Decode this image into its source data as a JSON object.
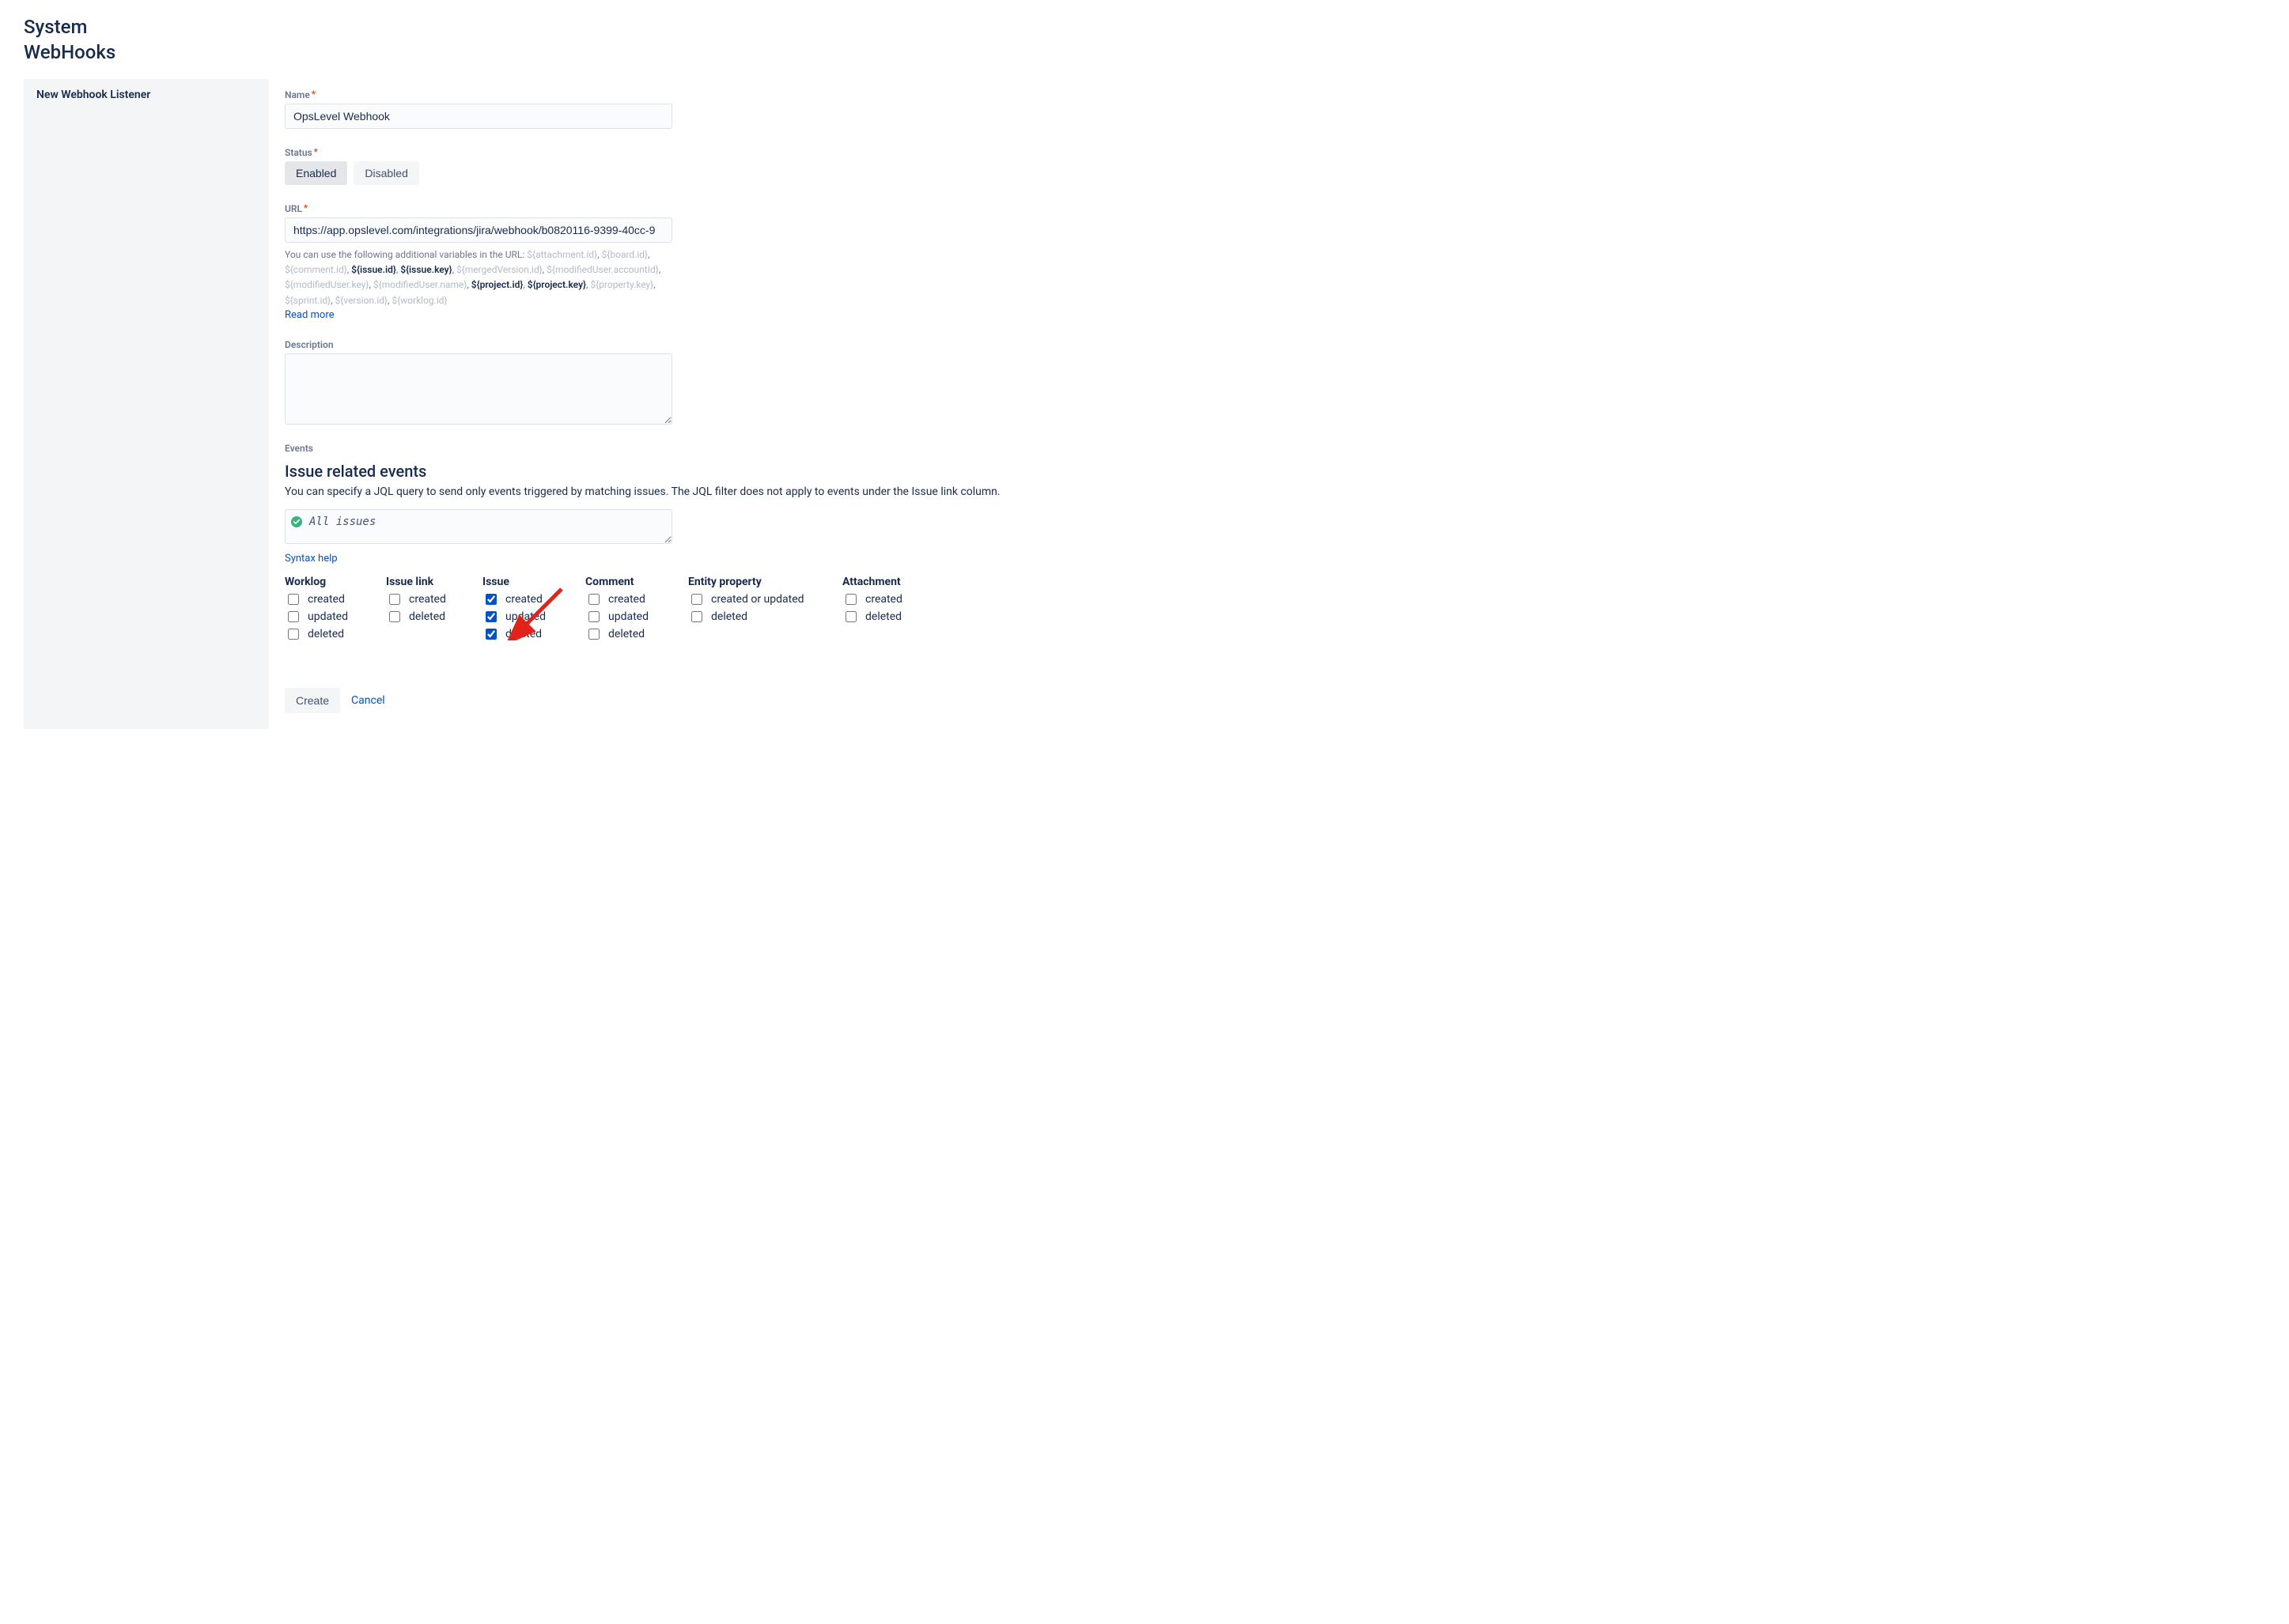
{
  "header": {
    "system": "System",
    "webhooks": "WebHooks"
  },
  "sidebar": {
    "title": "New Webhook Listener"
  },
  "form": {
    "name_label": "Name",
    "name_value": "OpsLevel Webhook",
    "status_label": "Status",
    "status_enabled": "Enabled",
    "status_disabled": "Disabled",
    "status_selected": "Enabled",
    "url_label": "URL",
    "url_value": "https://app.opslevel.com/integrations/jira/webhook/b0820116-9399-40cc-9",
    "url_help_prefix": "You can use the following additional variables in the URL: ",
    "url_variables": [
      {
        "name": "${attachment.id}",
        "enabled": false
      },
      {
        "name": "${board.id}",
        "enabled": false
      },
      {
        "name": "${comment.id}",
        "enabled": false
      },
      {
        "name": "${issue.id}",
        "enabled": true
      },
      {
        "name": "${issue.key}",
        "enabled": true
      },
      {
        "name": "${mergedVersion.id}",
        "enabled": false
      },
      {
        "name": "${modifiedUser.accountId}",
        "enabled": false
      },
      {
        "name": "${modifiedUser.key}",
        "enabled": false
      },
      {
        "name": "${modifiedUser.name}",
        "enabled": false
      },
      {
        "name": "${project.id}",
        "enabled": true
      },
      {
        "name": "${project.key}",
        "enabled": true
      },
      {
        "name": "${property.key}",
        "enabled": false
      },
      {
        "name": "${sprint.id}",
        "enabled": false
      },
      {
        "name": "${version.id}",
        "enabled": false
      },
      {
        "name": "${worklog.id}",
        "enabled": false
      }
    ],
    "read_more": "Read more",
    "description_label": "Description",
    "description_value": "",
    "events_label": "Events",
    "events_section_title": "Issue related events",
    "events_section_desc": "You can specify a JQL query to send only events triggered by matching issues. The JQL filter does not apply to events under the Issue link column.",
    "jql_value": "All issues",
    "syntax_help": "Syntax help",
    "event_columns": [
      {
        "id": "worklog",
        "header": "Worklog",
        "width": "col-worklog",
        "options": [
          {
            "label": "created",
            "checked": false
          },
          {
            "label": "updated",
            "checked": false
          },
          {
            "label": "deleted",
            "checked": false
          }
        ]
      },
      {
        "id": "issuelink",
        "header": "Issue link",
        "width": "col-issuelink",
        "options": [
          {
            "label": "created",
            "checked": false
          },
          {
            "label": "deleted",
            "checked": false
          }
        ]
      },
      {
        "id": "issue",
        "header": "Issue",
        "width": "col-issue",
        "options": [
          {
            "label": "created",
            "checked": true
          },
          {
            "label": "updated",
            "checked": true
          },
          {
            "label": "deleted",
            "checked": true
          }
        ]
      },
      {
        "id": "comment",
        "header": "Comment",
        "width": "col-comment",
        "options": [
          {
            "label": "created",
            "checked": false
          },
          {
            "label": "updated",
            "checked": false
          },
          {
            "label": "deleted",
            "checked": false
          }
        ]
      },
      {
        "id": "entity",
        "header": "Entity property",
        "width": "col-entity",
        "options": [
          {
            "label": "created or updated",
            "checked": false
          },
          {
            "label": "deleted",
            "checked": false
          }
        ]
      },
      {
        "id": "attachment",
        "header": "Attachment",
        "width": "col-attachment",
        "options": [
          {
            "label": "created",
            "checked": false
          },
          {
            "label": "deleted",
            "checked": false
          }
        ]
      }
    ]
  },
  "footer": {
    "create": "Create",
    "cancel": "Cancel"
  }
}
